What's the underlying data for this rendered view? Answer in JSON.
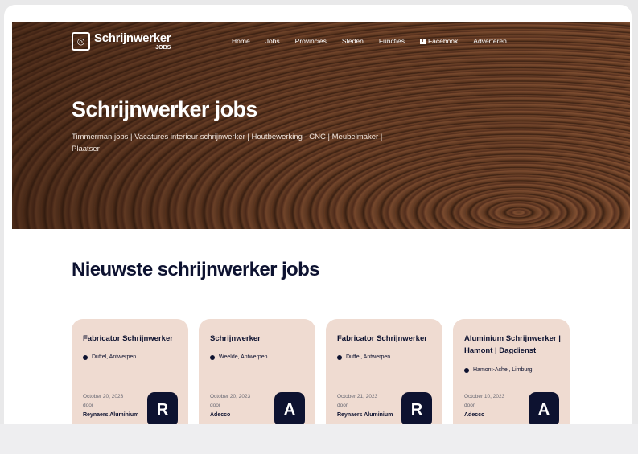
{
  "site": {
    "logo_main": "Schrijnwerker",
    "logo_sub": "JOBS"
  },
  "nav": {
    "items": [
      "Home",
      "Jobs",
      "Provincies",
      "Steden",
      "Functies",
      "Facebook",
      "Adverteren"
    ]
  },
  "hero": {
    "title": "Schrijnwerker jobs",
    "subtitle": "Timmerman jobs | Vacatures interieur schrijnwerker | Houtbewerking - CNC | Meubelmaker | Plaatser"
  },
  "section": {
    "title": "Nieuwste schrijnwerker jobs"
  },
  "cards": [
    {
      "title": "Fabricator Schrijnwerker",
      "location": "Duffel, Antwerpen",
      "date": "October 20, 2023",
      "by": "door",
      "company": "Reynaers Aluminium",
      "initial": "R"
    },
    {
      "title": "Schrijnwerker",
      "location": "Weelde, Antwerpen",
      "date": "October 20, 2023",
      "by": "door",
      "company": "Adecco",
      "initial": "A"
    },
    {
      "title": "Fabricator Schrijnwerker",
      "location": "Duffel, Antwerpen",
      "date": "October 21, 2023",
      "by": "door",
      "company": "Reynaers Aluminium",
      "initial": "R"
    },
    {
      "title": "Aluminium Schrijnwerker | Hamont | Dagdienst",
      "location": "Hamont-Achel, Limburg",
      "date": "October 10, 2023",
      "by": "door",
      "company": "Adecco",
      "initial": "A"
    }
  ],
  "colors": {
    "navy": "#0d1230",
    "card_bg": "#efdbd1",
    "wood": "#6b4128"
  }
}
